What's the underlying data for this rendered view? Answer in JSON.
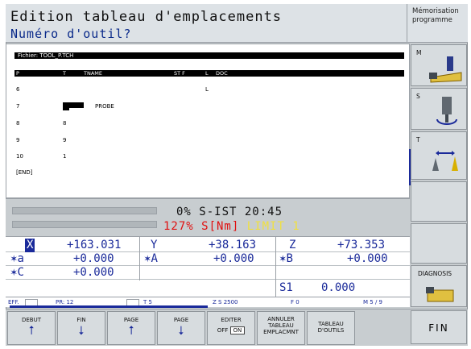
{
  "header": {
    "title": "Edition tableau d'emplacements",
    "subtitle": "Numéro d'outil?",
    "mode": "Mémorisation programme"
  },
  "table": {
    "file_label": "Fichier: TOOL_P.TCH",
    "columns": [
      "P",
      "T",
      "TNAME",
      "ST F",
      "L",
      "DOC"
    ],
    "rows": [
      {
        "p": "6",
        "t": "",
        "tname": "",
        "l": "L"
      },
      {
        "p": "7",
        "t": "2",
        "tname": "PROBE",
        "l": ""
      },
      {
        "p": "8",
        "t": "8",
        "tname": "",
        "l": ""
      },
      {
        "p": "9",
        "t": "9",
        "tname": "",
        "l": ""
      },
      {
        "p": "10",
        "t": "1",
        "tname": "",
        "l": ""
      },
      {
        "p": "[END]",
        "t": "",
        "tname": "",
        "l": ""
      }
    ]
  },
  "status": {
    "line1": "0% S-IST 20:45",
    "line2_a": "127% S[Nm]",
    "line2_b": "LIMIT 1"
  },
  "positions": {
    "x": {
      "axis": "X",
      "value": "+163.031"
    },
    "y": {
      "axis": "Y",
      "value": "+38.163"
    },
    "z": {
      "axis": "Z",
      "value": "+73.353"
    },
    "a": {
      "axis": "a",
      "value": "+0.000"
    },
    "A": {
      "axis": "A",
      "value": "+0.000"
    },
    "B": {
      "axis": "B",
      "value": "+0.000"
    },
    "C": {
      "axis": "C",
      "value": "+0.000"
    },
    "s1": {
      "axis": "S1",
      "value": "0.000"
    }
  },
  "info": {
    "eff": "EFF.",
    "pr": "PR: 12",
    "t": "T 5",
    "zs": "Z S 2500",
    "f": "F 0",
    "m": "M 5 / 9"
  },
  "softkeys": {
    "debut": "DEBUT",
    "fin": "FIN",
    "page_up": "PAGE",
    "page_down": "PAGE",
    "editer": "EDITER",
    "off": "OFF",
    "on": "ON",
    "annuler_1": "ANNULER",
    "annuler_2": "TABLEAU",
    "annuler_3": "EMPLACMNT",
    "tableau_1": "TABLEAU",
    "tableau_2": "D'OUTILS",
    "fin_main": "FIN"
  },
  "vertical_keys": {
    "m": "M",
    "s": "S",
    "t": "T",
    "diagnosis": "DIAGNOSIS"
  }
}
